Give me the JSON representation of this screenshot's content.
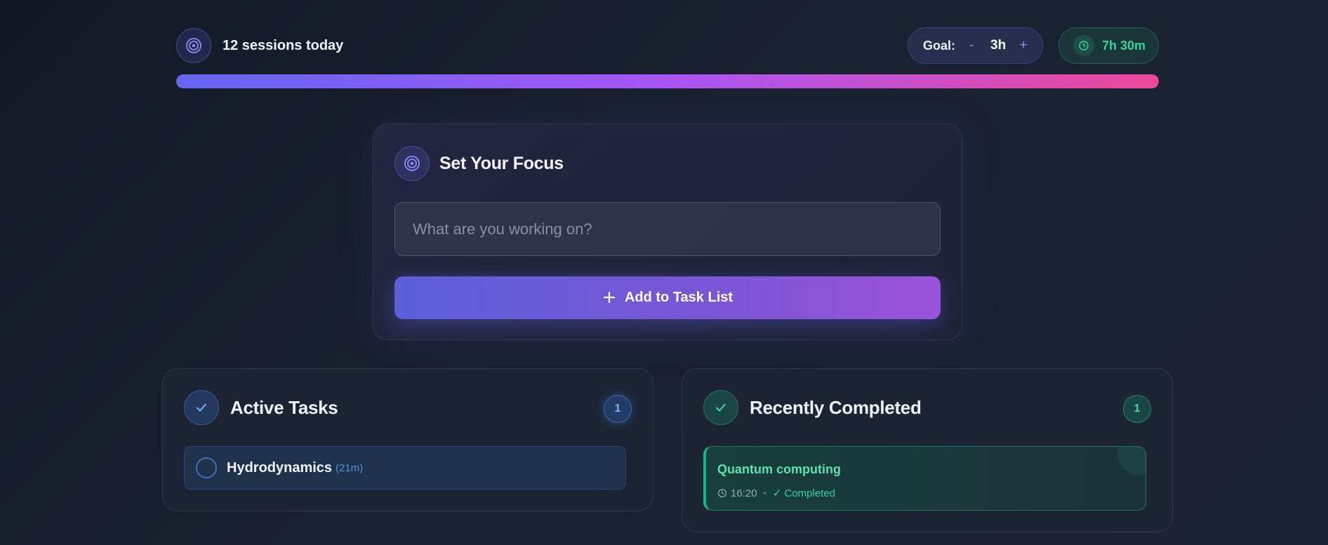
{
  "header": {
    "sessions_text": "12 sessions today",
    "goal": {
      "label": "Goal:",
      "decrement_label": "-",
      "value": "3h",
      "increment_label": "+"
    },
    "total_time": "7h 30m",
    "progress_fraction": 1.0
  },
  "focus": {
    "title": "Set Your Focus",
    "input_placeholder": "What are you working on?",
    "input_value": "",
    "add_button_label": "Add to Task List"
  },
  "active": {
    "title": "Active Tasks",
    "count": "1",
    "items": [
      {
        "name": "Hydrodynamics",
        "duration": "(21m)"
      }
    ]
  },
  "completed": {
    "title": "Recently Completed",
    "count": "1",
    "items": [
      {
        "name": "Quantum computing",
        "time": "16:20",
        "separator": "•",
        "status": "✓ Completed"
      }
    ]
  },
  "colors": {
    "accent_indigo": "#6366f1",
    "accent_purple": "#a855f7",
    "accent_pink": "#ec4899",
    "success_green": "#34d399",
    "info_blue": "#60a5fa"
  },
  "icons": {
    "sessions": "target-icon",
    "clock": "clock-icon",
    "focus": "target-icon",
    "add": "plus-icon",
    "active": "check-icon",
    "completed": "check-icon"
  }
}
